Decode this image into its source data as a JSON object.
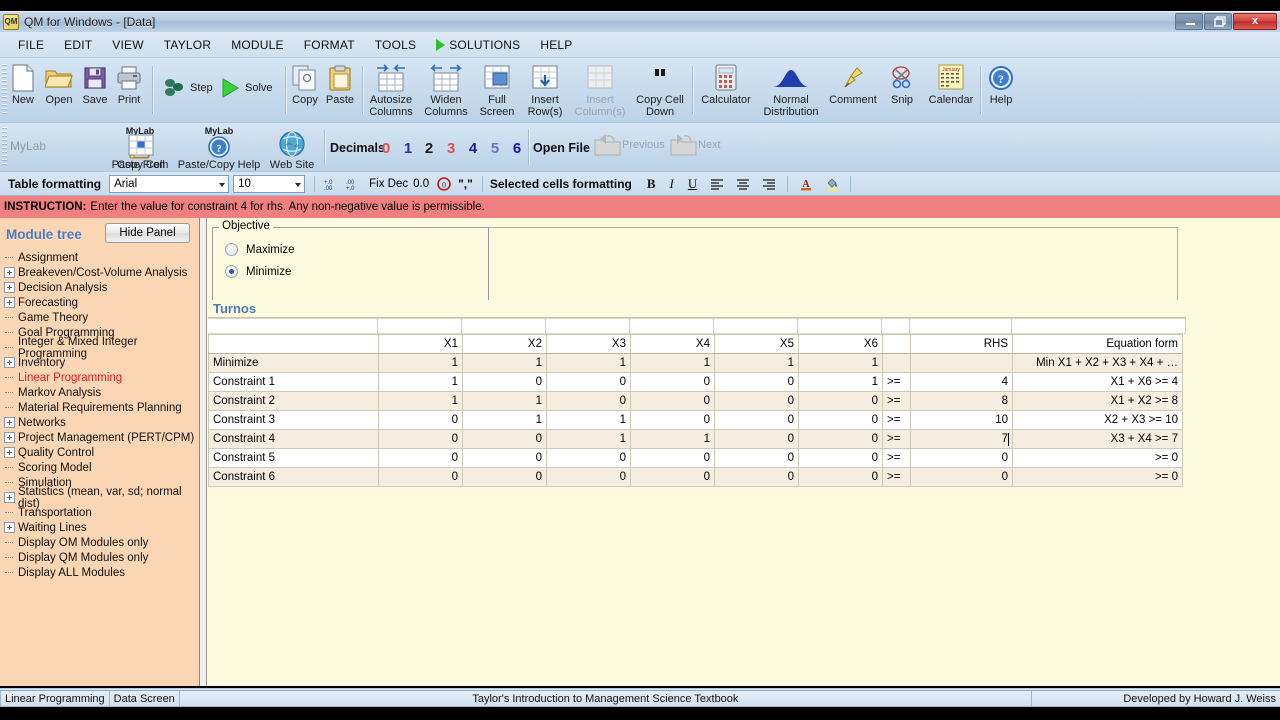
{
  "window": {
    "title": "QM for Windows - [Data]",
    "minimize_label": "–",
    "restore_label": "❑",
    "close_label": "x"
  },
  "menu": {
    "items": [
      {
        "label": "FILE",
        "name": "menu-file"
      },
      {
        "label": "EDIT",
        "name": "menu-edit"
      },
      {
        "label": "VIEW",
        "name": "menu-view"
      },
      {
        "label": "TAYLOR",
        "name": "menu-taylor"
      },
      {
        "label": "MODULE",
        "name": "menu-module"
      },
      {
        "label": "FORMAT",
        "name": "menu-format"
      },
      {
        "label": "TOOLS",
        "name": "menu-tools"
      },
      {
        "label": "SOLUTIONS",
        "name": "menu-solutions"
      },
      {
        "label": "HELP",
        "name": "menu-help"
      }
    ]
  },
  "toolbar_main": {
    "buttons": [
      {
        "label": "New",
        "icon": "new-document-icon",
        "enabled": true
      },
      {
        "label": "Open",
        "icon": "open-folder-icon",
        "enabled": true
      },
      {
        "label": "Save",
        "icon": "floppy-disk-icon",
        "enabled": true
      },
      {
        "label": "Print",
        "icon": "printer-icon",
        "enabled": true
      },
      {
        "label": "Step",
        "icon": "step-icon",
        "enabled": true
      },
      {
        "label": "Solve",
        "icon": "play-triangle-icon",
        "enabled": true
      },
      {
        "label": "Copy",
        "icon": "copy-icon",
        "enabled": true
      },
      {
        "label": "Paste",
        "icon": "clipboard-icon",
        "enabled": true
      },
      {
        "label": "Autosize Columns",
        "icon": "autosize-columns-icon",
        "enabled": true
      },
      {
        "label": "Widen Columns",
        "icon": "widen-columns-icon",
        "enabled": true
      },
      {
        "label": "Full Screen",
        "icon": "full-screen-icon",
        "enabled": true
      },
      {
        "label": "Insert Row(s)",
        "icon": "insert-row-icon",
        "enabled": true
      },
      {
        "label": "Insert Column(s)",
        "icon": "insert-column-icon",
        "enabled": false
      },
      {
        "label": "Copy Cell Down",
        "icon": "copy-cell-down-icon",
        "enabled": true
      },
      {
        "label": "Calculator",
        "icon": "calculator-icon",
        "enabled": true
      },
      {
        "label": "Normal Distribution",
        "icon": "normal-curve-icon",
        "enabled": true
      },
      {
        "label": "Comment",
        "icon": "pushpin-icon",
        "enabled": true
      },
      {
        "label": "Snip",
        "icon": "scissors-icon",
        "enabled": true
      },
      {
        "label": "Calendar",
        "icon": "calendar-icon",
        "enabled": true
      },
      {
        "label": "Help",
        "icon": "question-mark-icon",
        "enabled": true
      }
    ],
    "calendar_month": "January"
  },
  "toolbar_mylab": {
    "group_label": "MyLab",
    "buttons": [
      {
        "label": "Paste From",
        "badge": "MyLab",
        "icon": "paste-from-icon"
      },
      {
        "label": "Copy Cell",
        "badge": "",
        "icon": "copy-cell-icon"
      },
      {
        "label": "Paste/Copy Help",
        "badge": "MyLab",
        "icon": "paste-copy-help-icon"
      },
      {
        "label": "Web Site",
        "badge": "",
        "icon": "globe-icon"
      }
    ],
    "decimals_label": "Decimals",
    "decimals_options": [
      "0",
      "1",
      "2",
      "3",
      "4",
      "5",
      "6"
    ],
    "decimals_selected": "2",
    "decimals_colors": [
      "#d9534f",
      "#2f2fa8",
      "#1a1a1a",
      "#d9534f",
      "#1f1f8c",
      "#7070c0",
      "#1616a8"
    ],
    "open_file_label": "Open File",
    "previous_label": "Previous",
    "next_label": "Next"
  },
  "toolbar_format": {
    "table_formatting_label": "Table formatting",
    "font_family_value": "Arial",
    "font_size_value": "10",
    "increase_decimal_icon": "increase-decimal-icon",
    "decrease_decimal_icon": "decrease-decimal-icon",
    "fix_dec_label": "Fix Dec",
    "fix_dec_value": "0.0",
    "no_format_icon": "no-format-icon",
    "comma_label": "\",\"",
    "selected_cells_label": "Selected cells formatting",
    "bold_label": "B",
    "italic_label": "I",
    "underline_label": "U",
    "align_left_icon": "align-left-icon",
    "align_center_icon": "align-center-icon",
    "align_right_icon": "align-right-icon",
    "font_color_label": "A",
    "fill_color_icon": "fill-color-icon"
  },
  "instruction": {
    "prefix": "INSTRUCTION:",
    "text": "Enter the value for constraint 4 for rhs. Any non-negative value is permissible."
  },
  "sidebar": {
    "title": "Module tree",
    "hide_panel_label": "Hide Panel",
    "items": [
      {
        "label": "Assignment",
        "expandable": false,
        "active": false
      },
      {
        "label": "Breakeven/Cost-Volume Analysis",
        "expandable": true,
        "active": false
      },
      {
        "label": "Decision Analysis",
        "expandable": true,
        "active": false
      },
      {
        "label": "Forecasting",
        "expandable": true,
        "active": false
      },
      {
        "label": "Game Theory",
        "expandable": false,
        "active": false
      },
      {
        "label": "Goal Programming",
        "expandable": false,
        "active": false
      },
      {
        "label": "Integer & Mixed Integer Programming",
        "expandable": false,
        "active": false
      },
      {
        "label": "Inventory",
        "expandable": true,
        "active": false
      },
      {
        "label": "Linear Programming",
        "expandable": false,
        "active": true
      },
      {
        "label": "Markov Analysis",
        "expandable": false,
        "active": false
      },
      {
        "label": "Material Requirements Planning",
        "expandable": false,
        "active": false
      },
      {
        "label": "Networks",
        "expandable": true,
        "active": false
      },
      {
        "label": "Project Management (PERT/CPM)",
        "expandable": true,
        "active": false
      },
      {
        "label": "Quality Control",
        "expandable": true,
        "active": false
      },
      {
        "label": "Scoring Model",
        "expandable": false,
        "active": false
      },
      {
        "label": "Simulation",
        "expandable": false,
        "active": false
      },
      {
        "label": "Statistics (mean, var, sd; normal dist)",
        "expandable": true,
        "active": false
      },
      {
        "label": "Transportation",
        "expandable": false,
        "active": false
      },
      {
        "label": "Waiting Lines",
        "expandable": true,
        "active": false
      },
      {
        "label": "Display OM Modules only",
        "expandable": false,
        "active": false
      },
      {
        "label": "Display QM Modules only",
        "expandable": false,
        "active": false
      },
      {
        "label": "Display ALL Modules",
        "expandable": false,
        "active": false
      }
    ]
  },
  "objective": {
    "legend": "Objective",
    "maximize_label": "Maximize",
    "minimize_label": "Minimize",
    "selected": "Minimize"
  },
  "data_table": {
    "title": "Turnos",
    "columns": [
      "",
      "X1",
      "X2",
      "X3",
      "X4",
      "X5",
      "X6",
      "",
      "RHS",
      "Equation form"
    ],
    "rows": [
      {
        "label": "Minimize",
        "x1": "1",
        "x2": "1",
        "x3": "1",
        "x4": "1",
        "x5": "1",
        "x6": "1",
        "rel": "",
        "rhs": "",
        "eq": "Min X1 + X2 + X3 + X4 + …",
        "editing": false
      },
      {
        "label": "Constraint 1",
        "x1": "1",
        "x2": "0",
        "x3": "0",
        "x4": "0",
        "x5": "0",
        "x6": "1",
        "rel": ">=",
        "rhs": "4",
        "eq": "X1 + X6 >= 4",
        "editing": false
      },
      {
        "label": "Constraint 2",
        "x1": "1",
        "x2": "1",
        "x3": "0",
        "x4": "0",
        "x5": "0",
        "x6": "0",
        "rel": ">=",
        "rhs": "8",
        "eq": "X1 + X2 >= 8",
        "editing": false
      },
      {
        "label": "Constraint 3",
        "x1": "0",
        "x2": "1",
        "x3": "1",
        "x4": "0",
        "x5": "0",
        "x6": "0",
        "rel": ">=",
        "rhs": "10",
        "eq": "X2 + X3 >= 10",
        "editing": false
      },
      {
        "label": "Constraint 4",
        "x1": "0",
        "x2": "0",
        "x3": "1",
        "x4": "1",
        "x5": "0",
        "x6": "0",
        "rel": ">=",
        "rhs": "7",
        "eq": "X3 + X4 >= 7",
        "editing": true
      },
      {
        "label": "Constraint 5",
        "x1": "0",
        "x2": "0",
        "x3": "0",
        "x4": "0",
        "x5": "0",
        "x6": "0",
        "rel": ">=",
        "rhs": "0",
        "eq": ">= 0",
        "editing": false
      },
      {
        "label": "Constraint 6",
        "x1": "0",
        "x2": "0",
        "x3": "0",
        "x4": "0",
        "x5": "0",
        "x6": "0",
        "rel": ">=",
        "rhs": "0",
        "eq": ">= 0",
        "editing": false
      }
    ]
  },
  "statusbar": {
    "module": "Linear Programming",
    "screen": "Data Screen",
    "center": "Taylor's Introduction to Management Science Textbook",
    "right": "Developed by Howard J. Weiss"
  },
  "colors": {
    "accent_blue": "#4a7bbd",
    "instruction_red": "#f08080",
    "sidebar_peach": "#fbd6b4",
    "workspace_cream": "#fdfae0",
    "active_item_red": "#e02020",
    "row_alt": "#f7ece0"
  }
}
